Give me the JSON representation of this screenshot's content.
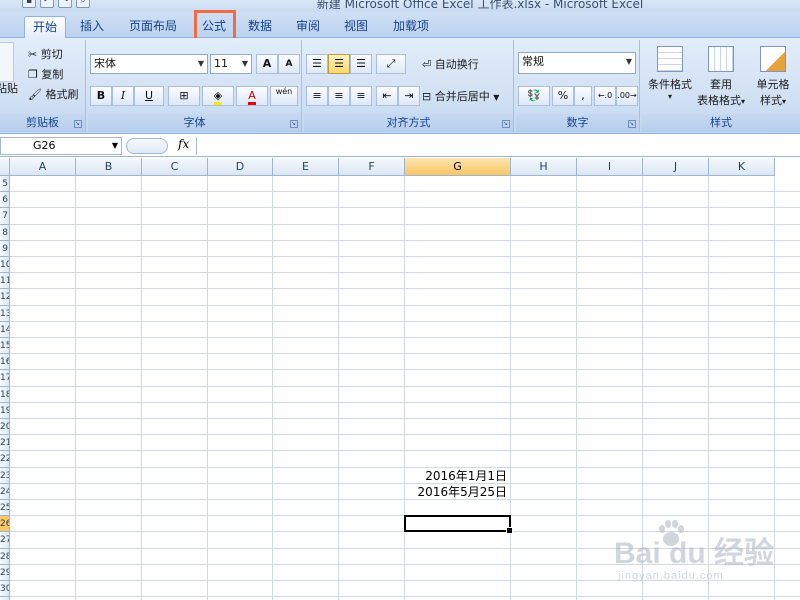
{
  "window": {
    "title": "新建 Microsoft Office Excel 工作表.xlsx - Microsoft Excel"
  },
  "tabs": [
    {
      "label": "开始",
      "active": true
    },
    {
      "label": "插入",
      "active": false
    },
    {
      "label": "页面布局",
      "active": false
    },
    {
      "label": "公式",
      "active": false,
      "highlighted": true
    },
    {
      "label": "数据",
      "active": false
    },
    {
      "label": "审阅",
      "active": false
    },
    {
      "label": "视图",
      "active": false
    },
    {
      "label": "加载项",
      "active": false
    }
  ],
  "ribbon": {
    "clipboard": {
      "label": "剪贴板",
      "paste": "粘贴",
      "cut": "剪切",
      "copy": "复制",
      "format_painter": "格式刷"
    },
    "font": {
      "label": "字体",
      "font_name": "宋体",
      "font_size": "11",
      "bold": "B",
      "italic": "I",
      "underline": "U",
      "font_color_glyph": "A",
      "grow": "A",
      "shrink": "A",
      "phonetic": "wén"
    },
    "alignment": {
      "label": "对齐方式",
      "wrap_text": "自动换行",
      "merge_center": "合并后居中"
    },
    "number": {
      "label": "数字",
      "format": "常规",
      "percent": "%",
      "comma": ","
    },
    "styles": {
      "label": "样式",
      "conditional": "条件格式",
      "table_format_1": "套用",
      "table_format_2": "表格格式",
      "cell_styles_1": "单元格",
      "cell_styles_2": "样式"
    }
  },
  "formula_bar": {
    "name_box": "G26",
    "fx": "fx",
    "formula": ""
  },
  "sheet": {
    "columns": [
      "A",
      "B",
      "C",
      "D",
      "E",
      "F",
      "G",
      "H",
      "I",
      "J",
      "K"
    ],
    "selected_column": "G",
    "cells": [
      {
        "ref": "G23",
        "value": "2016年1月1日"
      },
      {
        "ref": "G24",
        "value": "2016年5月25日"
      }
    ],
    "active_cell": "G26"
  },
  "watermark": {
    "brand": "Bai du 经验",
    "url": "jingyan.baidu.com"
  }
}
